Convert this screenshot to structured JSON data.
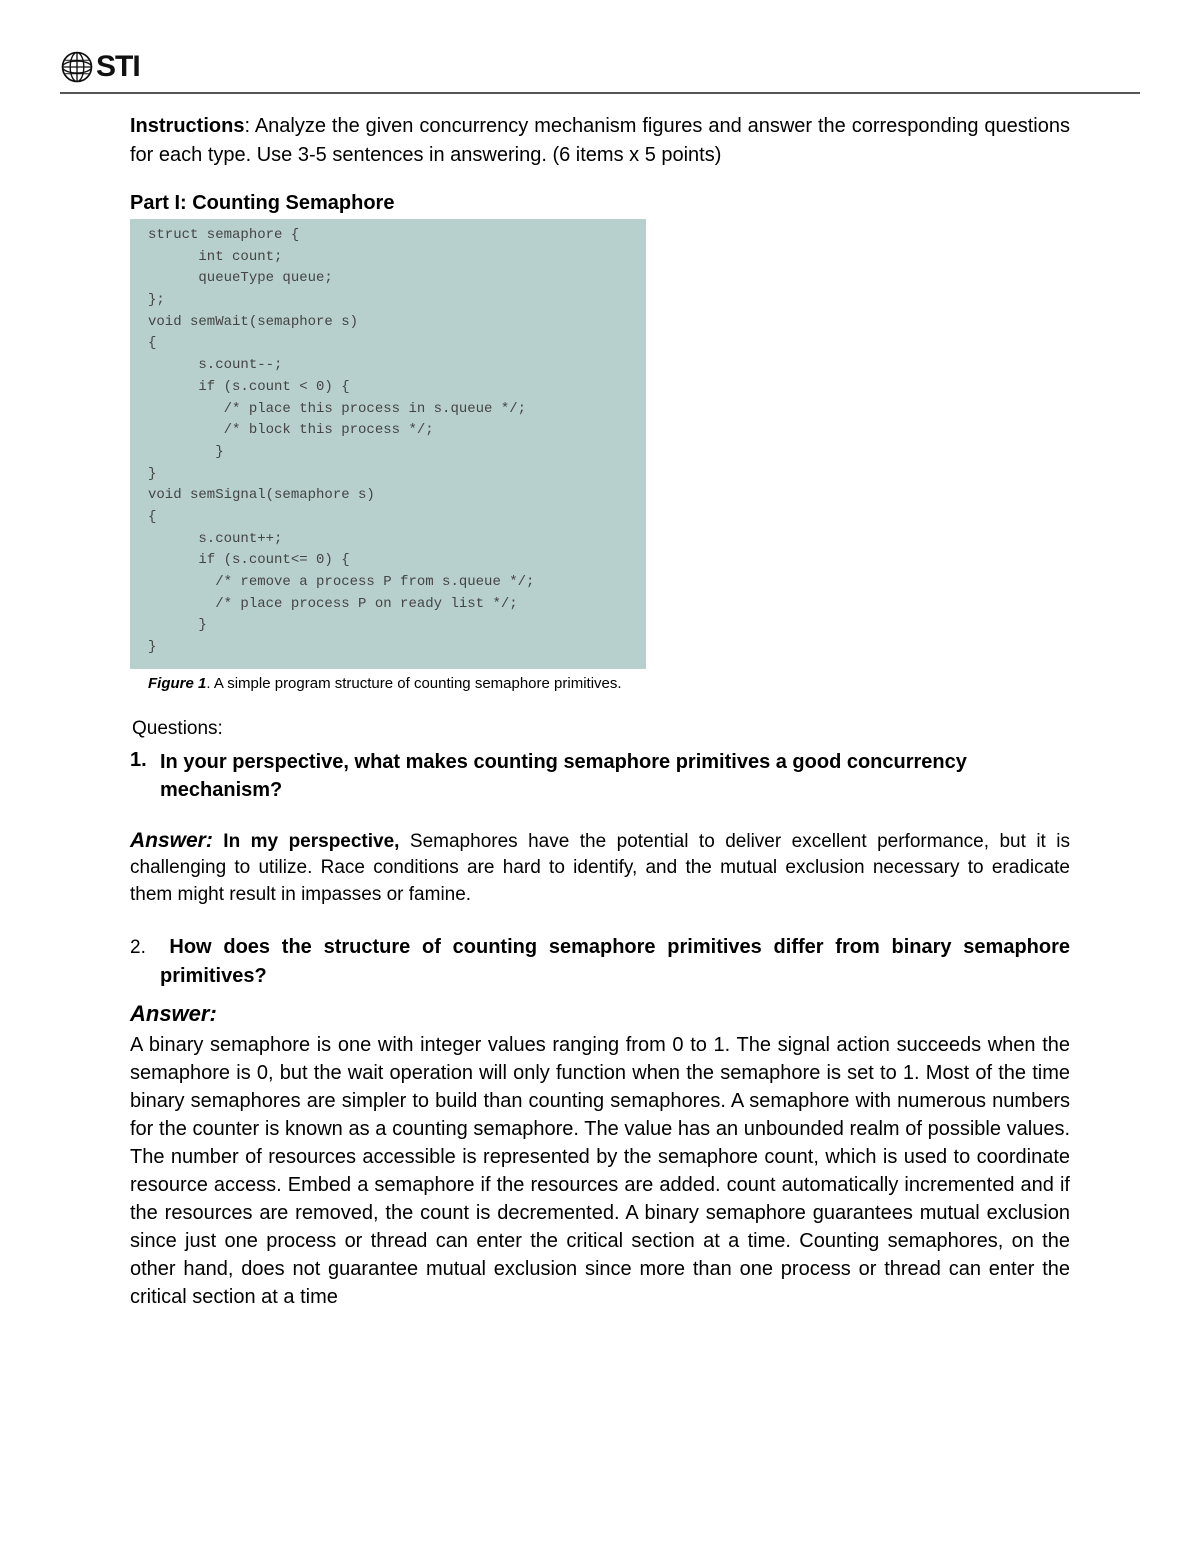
{
  "logo_text": "STI",
  "instructions": {
    "label": "Instructions",
    "body": ": Analyze the given concurrency mechanism figures and answer the corresponding questions for each type. Use 3-5 sentences in answering. (6 items x 5 points)"
  },
  "part1_title": "Part I: Counting Semaphore",
  "code": "struct semaphore {\n      int count;\n      queueType queue;\n};\nvoid semWait(semaphore s)\n{\n      s.count--;\n      if (s.count < 0) {\n         /* place this process in s.queue */;\n         /* block this process */;\n        }\n}\nvoid semSignal(semaphore s)\n{\n      s.count++;\n      if (s.count<= 0) {\n        /* remove a process P from s.queue */;\n        /* place process P on ready list */;\n      }\n}",
  "figure_caption": {
    "label": "Figure 1",
    "text": ". A simple program structure of counting semaphore primitives."
  },
  "questions_intro": "Questions:",
  "q1": {
    "num": "1.",
    "text": "In your perspective, what makes counting semaphore primitives a good concurrency mechanism?"
  },
  "a1": {
    "label": "Answer:",
    "lead": " In my perspective,",
    "body": " Semaphores have the potential to deliver excellent performance, but it is challenging to utilize. Race conditions are hard to identify, and the mutual exclusion necessary to eradicate them might result in impasses or famine."
  },
  "q2": {
    "num": "2.",
    "text": "How does the structure of counting semaphore primitives differ from binary semaphore primitives?"
  },
  "a2": {
    "label": "Answer:",
    "body": " A binary semaphore is one with integer values ranging from 0 to 1. The signal action succeeds when the semaphore is 0, but the wait operation will only function when the semaphore is set to 1. Most of the time binary semaphores are simpler to build than counting semaphores. A semaphore with numerous numbers for the counter is known as a counting semaphore. The value has an unbounded realm of possible values. The number of resources accessible is represented by the semaphore count, which is used to coordinate resource access. Embed a semaphore if the resources are added. count automatically incremented and if the resources are removed, the count is decremented. A binary semaphore guarantees mutual exclusion since just one process or thread can enter the critical section at a time. Counting semaphores, on the other hand, does not guarantee mutual exclusion since more than one process or thread can enter the critical section at a time"
  }
}
